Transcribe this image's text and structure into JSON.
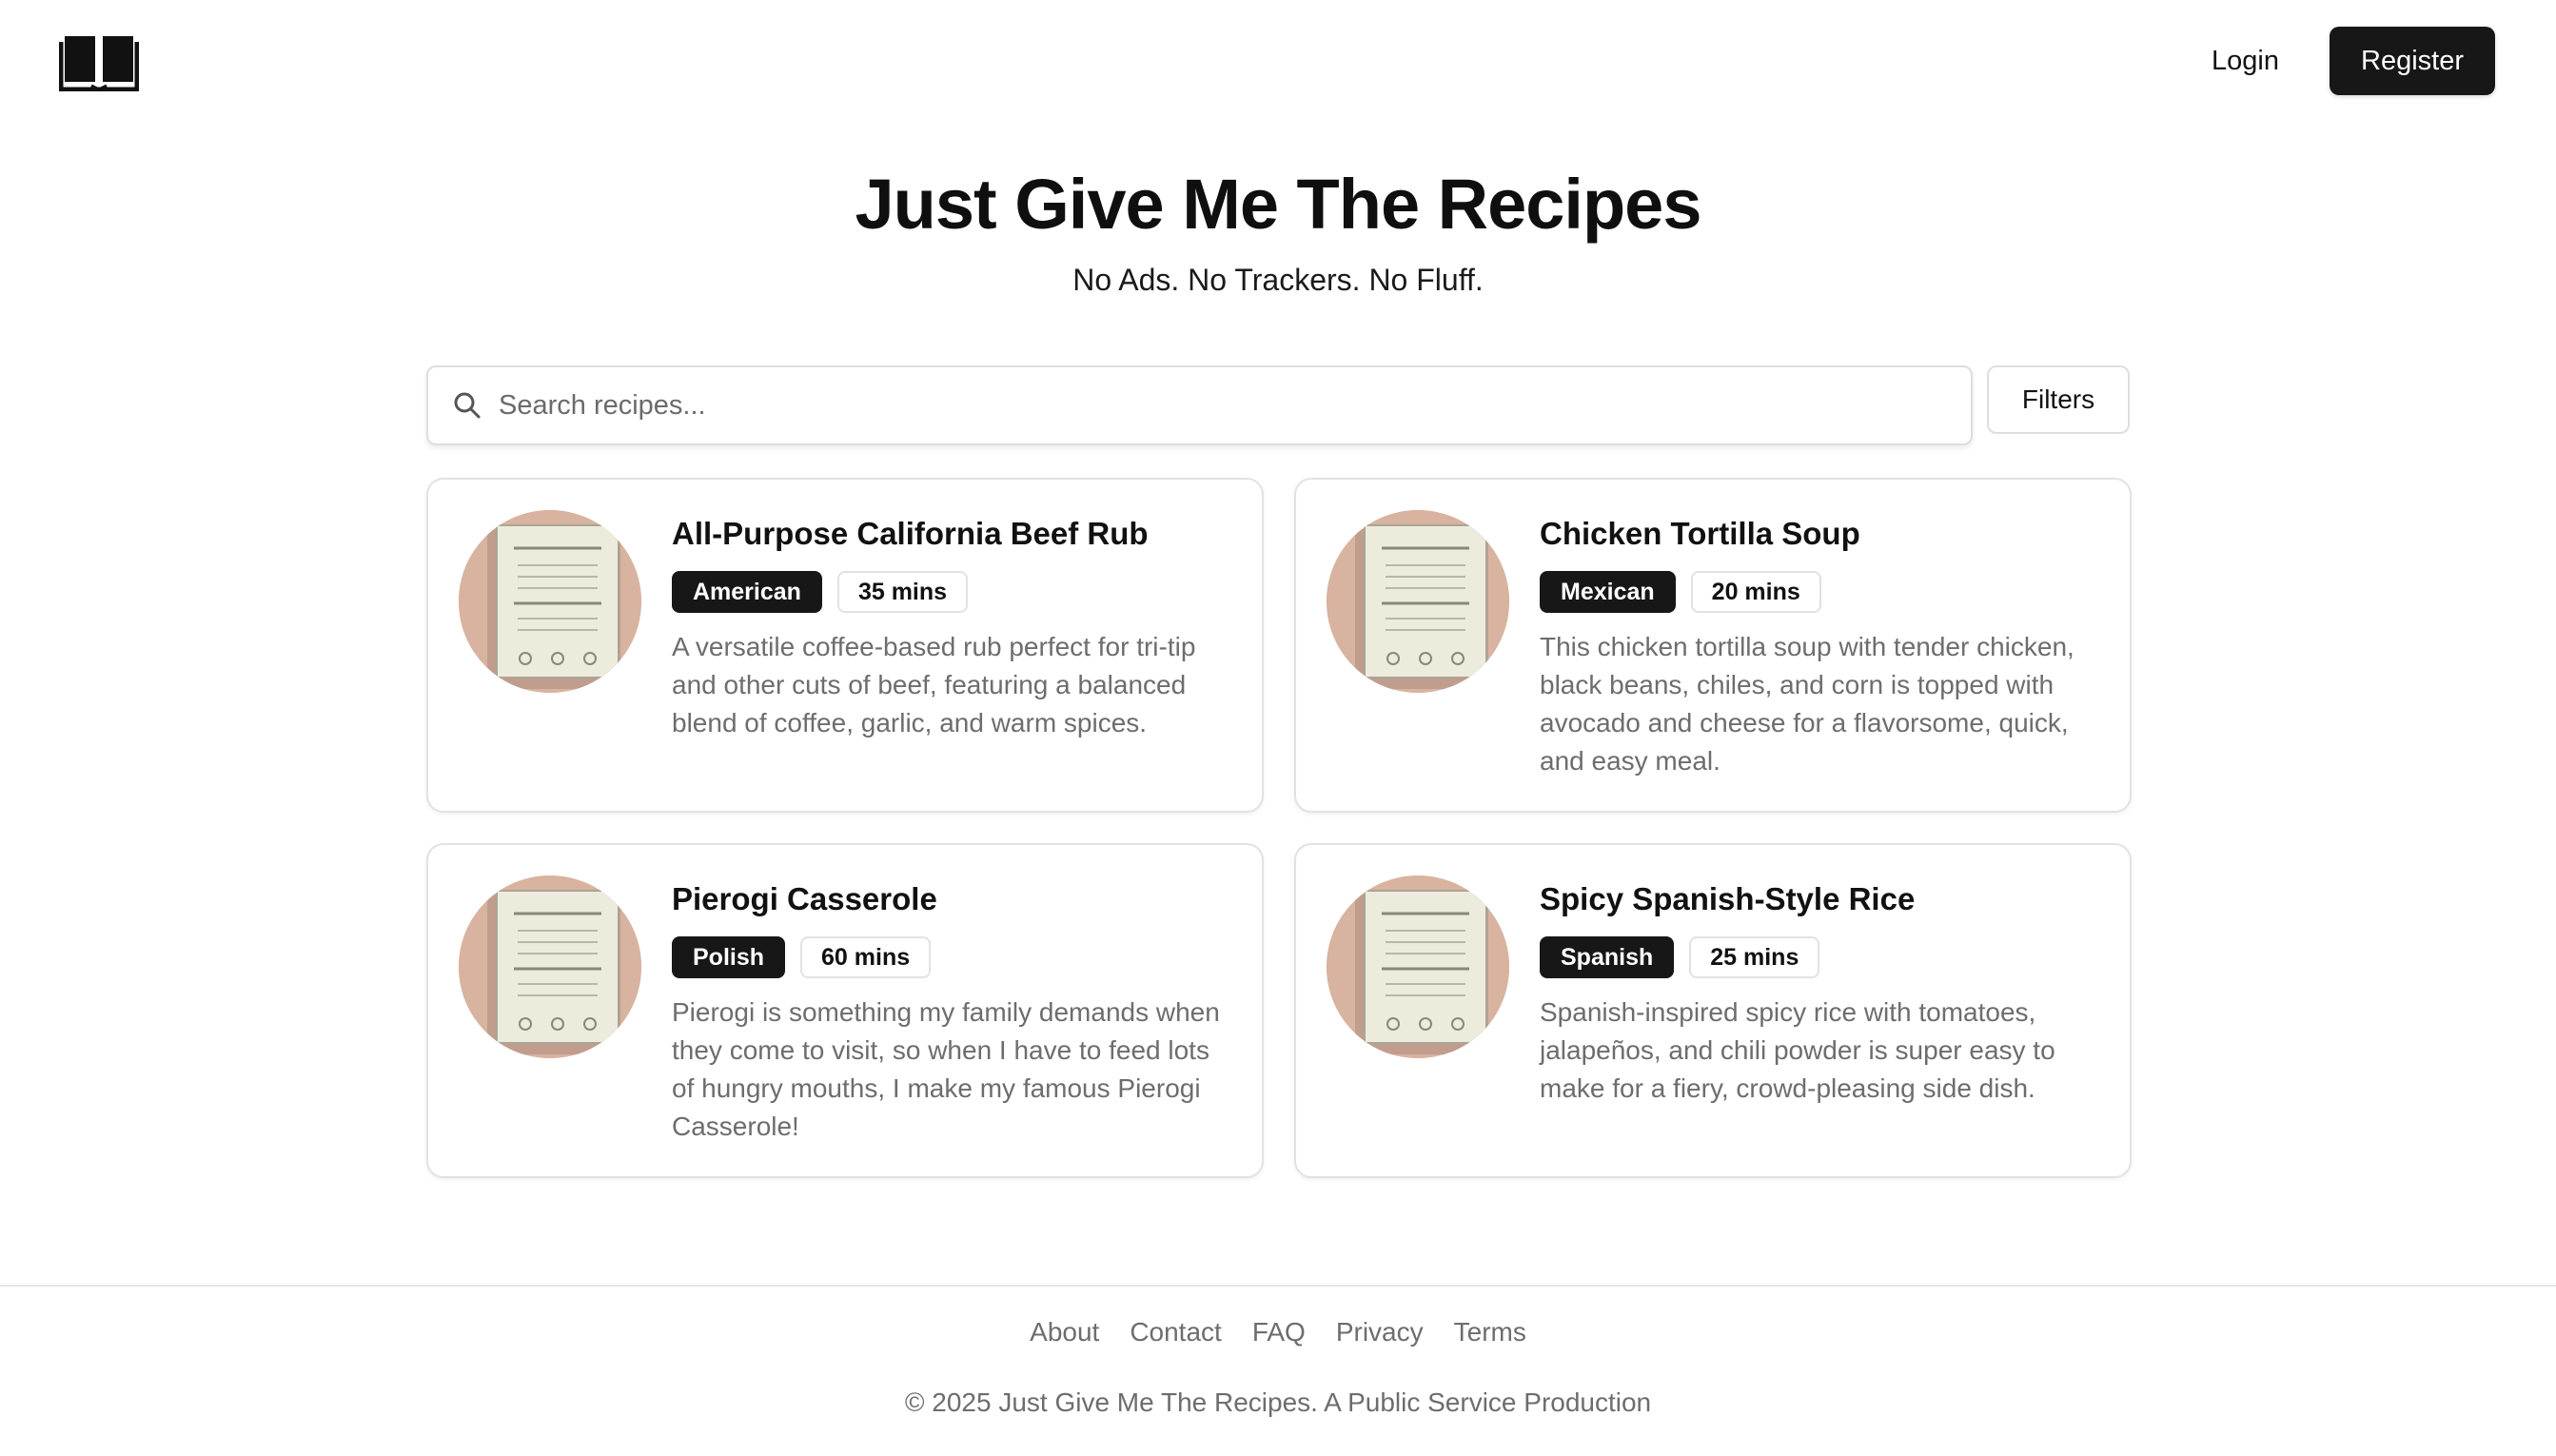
{
  "header": {
    "logo_icon": "open-book-icon",
    "login_label": "Login",
    "register_label": "Register"
  },
  "hero": {
    "title": "Just Give Me The Recipes",
    "subtitle": "No Ads. No Trackers. No Fluff."
  },
  "search": {
    "icon": "search-icon",
    "placeholder": "Search recipes...",
    "value": "",
    "filters_label": "Filters"
  },
  "recipes": [
    {
      "title": "All-Purpose California Beef Rub",
      "cuisine": "American",
      "time": "35 mins",
      "description": "A versatile coffee-based rub perfect for tri-tip and other cuts of beef, featuring a balanced blend of coffee, garlic, and warm spices."
    },
    {
      "title": "Chicken Tortilla Soup",
      "cuisine": "Mexican",
      "time": "20 mins",
      "description": "This chicken tortilla soup with tender chicken, black beans, chiles, and corn is topped with avocado and cheese for a flavorsome, quick, and easy meal."
    },
    {
      "title": "Pierogi Casserole",
      "cuisine": "Polish",
      "time": "60 mins",
      "description": "Pierogi is something my family demands when they come to visit, so when I have to feed lots of hungry mouths, I make my famous Pierogi Casserole!"
    },
    {
      "title": "Spicy Spanish-Style Rice",
      "cuisine": "Spanish",
      "time": "25 mins",
      "description": "Spanish-inspired spicy rice with tomatoes, jalapeños, and chili powder is super easy to make for a fiery, crowd-pleasing side dish."
    }
  ],
  "footer": {
    "links": [
      "About",
      "Contact",
      "FAQ",
      "Privacy",
      "Terms"
    ],
    "copyright": "© 2025 Just Give Me The Recipes. A Public Service Production"
  },
  "colors": {
    "primary": "#171717",
    "muted_text": "#6d6d6d",
    "border": "#e2e2e2",
    "thumb_bg": "#d8b3a0"
  }
}
